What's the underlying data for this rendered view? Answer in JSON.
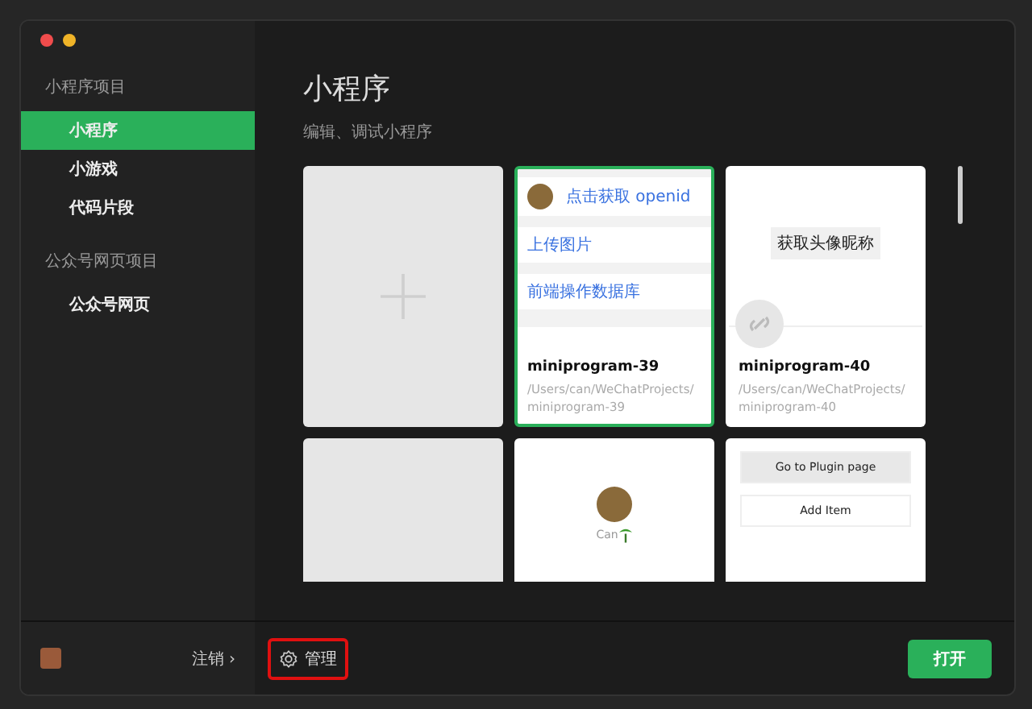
{
  "sidebar": {
    "groups": [
      {
        "title": "小程序项目",
        "items": [
          {
            "label": "小程序",
            "selected": true
          },
          {
            "label": "小游戏",
            "selected": false
          },
          {
            "label": "代码片段",
            "selected": false
          }
        ]
      },
      {
        "title": "公众号网页项目",
        "items": [
          {
            "label": "公众号网页",
            "selected": false
          }
        ]
      }
    ],
    "logout": "注销",
    "logout_arrow": "›"
  },
  "main": {
    "title": "小程序",
    "subtitle": "编辑、调试小程序",
    "cards": [
      {
        "kind": "new",
        "selected": false
      },
      {
        "kind": "project",
        "selected": true,
        "name": "miniprogram-39",
        "path": "/Users/can/WeChatProjects/miniprogram-39",
        "preview": {
          "kind": "list",
          "header": "点击获取 openid",
          "rows": [
            "上传图片",
            "前端操作数据库"
          ]
        }
      },
      {
        "kind": "project",
        "selected": false,
        "name": "miniprogram-40",
        "path": "/Users/can/WeChatProjects/miniprogram-40",
        "preview": {
          "kind": "button",
          "label": "获取头像昵称"
        }
      },
      {
        "kind": "blank",
        "selected": false
      },
      {
        "kind": "profile",
        "selected": false,
        "caption": "Can"
      },
      {
        "kind": "plugin",
        "selected": false,
        "buttons": [
          "Go to Plugin page",
          "Add Item"
        ]
      }
    ]
  },
  "footer": {
    "manage": "管理",
    "open": "打开"
  }
}
